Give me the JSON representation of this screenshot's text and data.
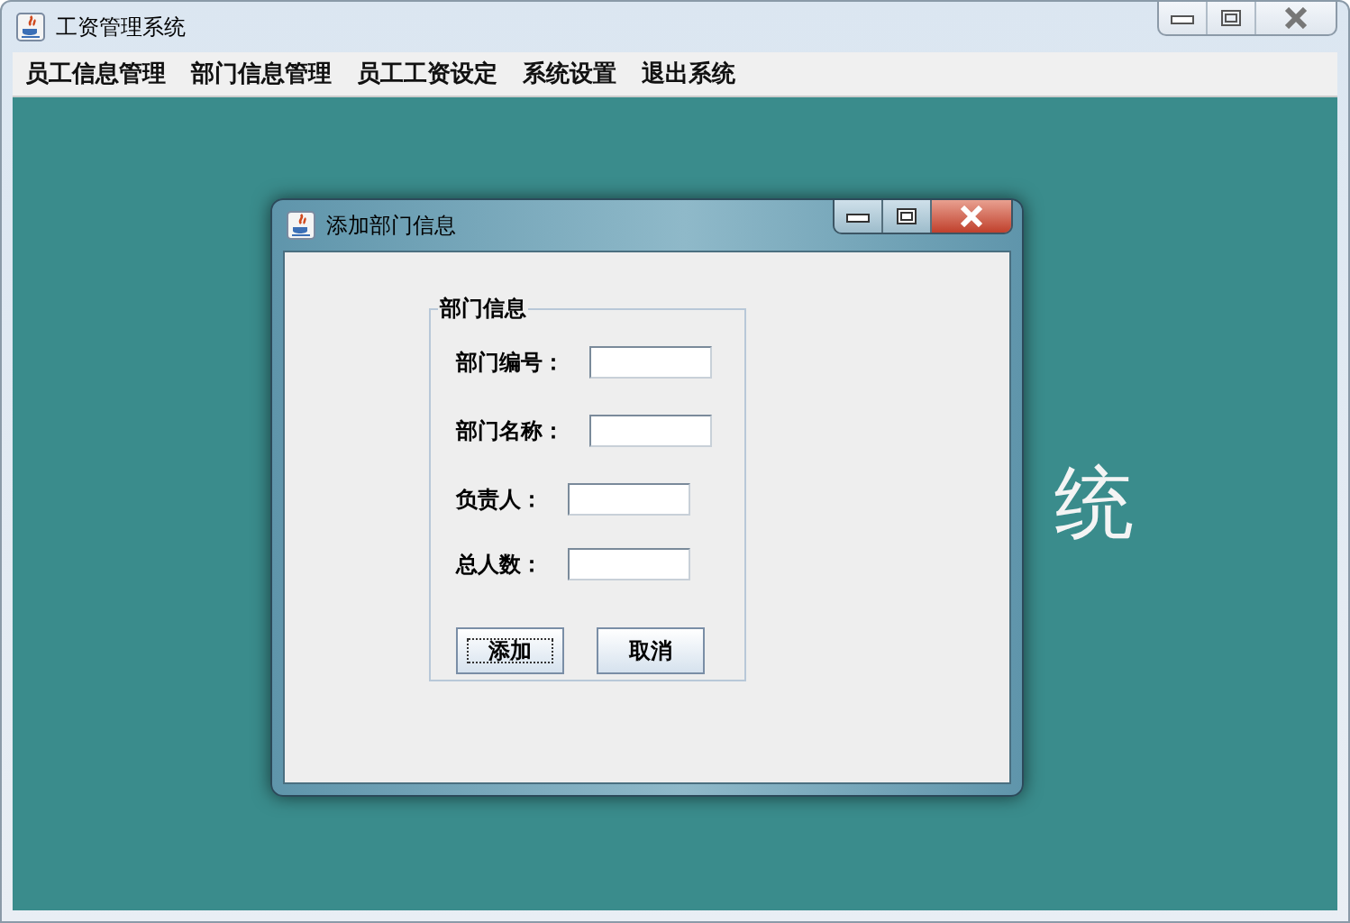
{
  "window": {
    "title": "工资管理系统"
  },
  "menu": [
    {
      "label": "员工信息管理"
    },
    {
      "label": "部门信息管理"
    },
    {
      "label": "员工工资设定"
    },
    {
      "label": "系统设置"
    },
    {
      "label": "退出系统"
    }
  ],
  "background_text": "统",
  "dialog": {
    "title": "添加部门信息",
    "group_title": "部门信息",
    "fields": [
      {
        "label": "部门编号："
      },
      {
        "label": "部门名称："
      },
      {
        "label": "负责人："
      },
      {
        "label": "总人数："
      }
    ],
    "buttons": [
      {
        "label": "添加",
        "focused": true
      },
      {
        "label": "取消",
        "focused": false
      }
    ]
  }
}
